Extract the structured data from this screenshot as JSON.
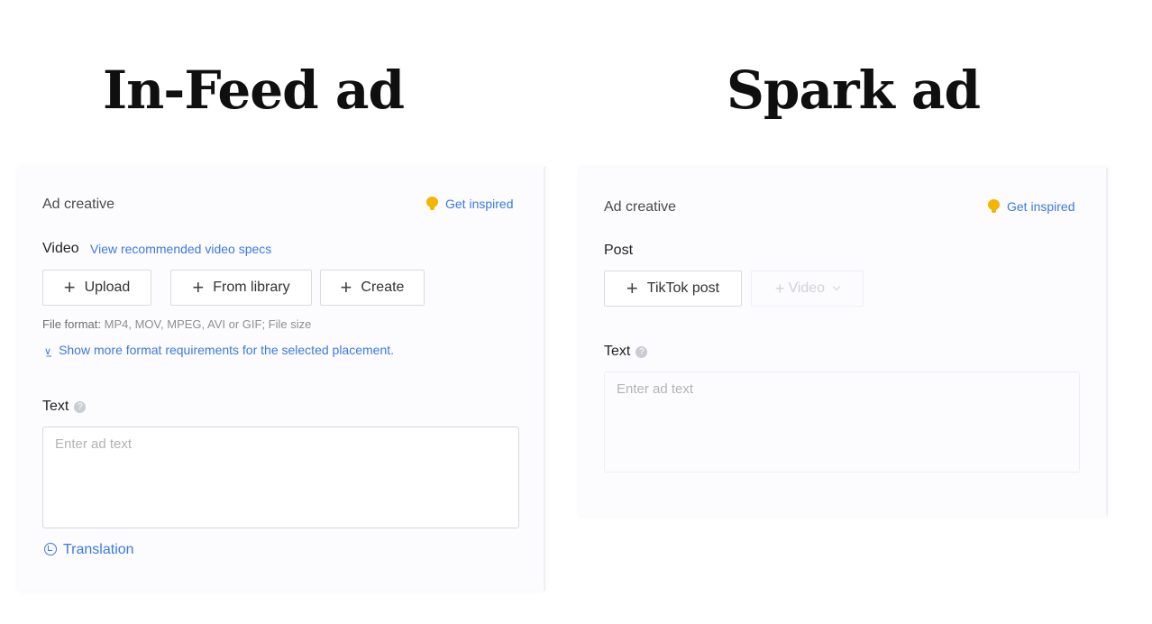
{
  "headings": {
    "left": "In-Feed ad",
    "right": "Spark ad"
  },
  "infeed": {
    "section_title": "Ad creative",
    "get_inspired": "Get inspired",
    "video_label": "Video",
    "video_specs_link": "View recommended video specs",
    "buttons": {
      "upload": "Upload",
      "from_library": "From library",
      "create": "Create"
    },
    "file_format_label": "File format:",
    "file_format_value": "MP4, MOV, MPEG, AVI or GIF; File size",
    "show_more_link": "Show more format requirements for the selected placement.",
    "text_label": "Text",
    "text_placeholder": "Enter ad text",
    "translation_link": "Translation"
  },
  "spark": {
    "section_title": "Ad creative",
    "get_inspired": "Get inspired",
    "post_label": "Post",
    "buttons": {
      "tiktok_post": "TikTok post",
      "video": "Video"
    },
    "text_label": "Text",
    "text_placeholder": "Enter ad text"
  },
  "colors": {
    "accent": "#3b7ae0",
    "bulb": "#f5b400"
  },
  "icons": {
    "plus": "+",
    "question": "?"
  }
}
